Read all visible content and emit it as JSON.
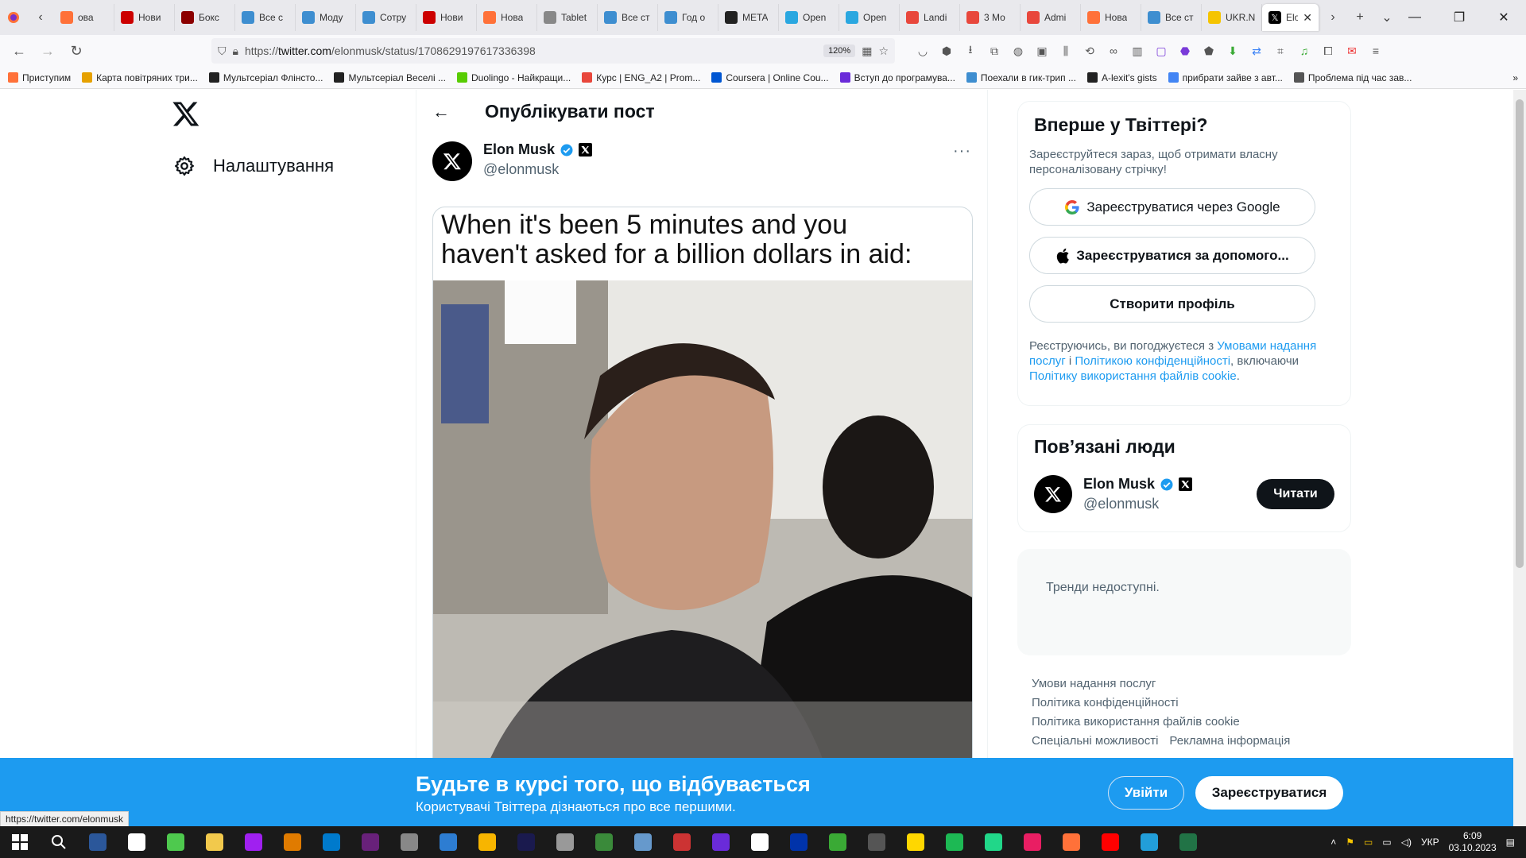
{
  "browser": {
    "tabs": [
      {
        "label": "ова",
        "color": "#ff7139"
      },
      {
        "label": "Нови",
        "color": "#c00"
      },
      {
        "label": "Бокс",
        "color": "#8b0000"
      },
      {
        "label": "Все с",
        "color": "#3e8ed0"
      },
      {
        "label": "Моду",
        "color": "#3e8ed0"
      },
      {
        "label": "Сотру",
        "color": "#3e8ed0"
      },
      {
        "label": "Нови",
        "color": "#c00"
      },
      {
        "label": "Нова",
        "color": "#ff7139"
      },
      {
        "label": "Tablet",
        "color": "#888"
      },
      {
        "label": "Все ст",
        "color": "#3e8ed0"
      },
      {
        "label": "Год о",
        "color": "#3e8ed0"
      },
      {
        "label": "META",
        "color": "#222"
      },
      {
        "label": "Open",
        "color": "#2aa7e0"
      },
      {
        "label": "Open",
        "color": "#2aa7e0"
      },
      {
        "label": "Landi",
        "color": "#e8473c"
      },
      {
        "label": "3 Мо",
        "color": "#e8473c"
      },
      {
        "label": "Admi",
        "color": "#e8473c"
      },
      {
        "label": "Нова",
        "color": "#ff7139"
      },
      {
        "label": "Все ст",
        "color": "#3e8ed0"
      },
      {
        "label": "UKR.N",
        "color": "#f5c400"
      }
    ],
    "active_tab": {
      "label": "Elo",
      "close": "✕"
    },
    "url_prefix": "https://",
    "url_domain": "twitter.com",
    "url_path": "/elonmusk/status/1708629197617336398",
    "zoom": "120%",
    "bookmarks": [
      {
        "label": "Приступим",
        "color": "#ff7139"
      },
      {
        "label": "Карта повітряних три...",
        "color": "#e6a100"
      },
      {
        "label": "Мультсеріал Флінсто...",
        "color": "#222"
      },
      {
        "label": "Мультсеріал Веселі ...",
        "color": "#222"
      },
      {
        "label": "Duolingo - Найкращи...",
        "color": "#58cc02"
      },
      {
        "label": "Курс | ENG_A2 | Prom...",
        "color": "#e8473c"
      },
      {
        "label": "Coursera | Online Cou...",
        "color": "#0056d2"
      },
      {
        "label": "Вступ до програмува...",
        "color": "#6a2bd9"
      },
      {
        "label": "Поехали в гик-трип ...",
        "color": "#3e8ed0"
      },
      {
        "label": "A-lexit's gists",
        "color": "#222"
      },
      {
        "label": "прибрати зайве з авт...",
        "color": "#4285f4"
      },
      {
        "label": "Проблема під час зав...",
        "color": "#555"
      }
    ]
  },
  "sidebar": {
    "settings_label": "Налаштування"
  },
  "post": {
    "header_title": "Опублікувати пост",
    "author_name": "Elon Musk",
    "author_handle": "@elonmusk",
    "more": "···",
    "meme_line1": "When it's been 5 minutes and you",
    "meme_line2": "haven't asked for a billion dollars in aid:"
  },
  "signup": {
    "title": "Вперше у Твіттері?",
    "subtitle": "Зареєструйтеся зараз, щоб отримати власну персоналізовану стрічку!",
    "google_btn": "Зареєструватися через Google",
    "apple_btn": "Зареєструватися за допомого...",
    "create_btn": "Створити профіль",
    "legal_pre": "Реєструючись, ви погоджуєтеся з ",
    "legal_tos": "Умовами надання послуг",
    "legal_and": " і ",
    "legal_privacy": "Політикою конфіденційності",
    "legal_mid": ", включаючи ",
    "legal_cookies": "Політику використання файлів cookie",
    "legal_end": "."
  },
  "related": {
    "title": "Пов’язані люди",
    "name": "Elon Musk",
    "handle": "@elonmusk",
    "follow_label": "Читати"
  },
  "trends": {
    "text": "Тренди недоступні."
  },
  "footer": {
    "links": [
      "Умови надання послуг",
      "Політика конфіденційності",
      "Політика використання файлів cookie",
      "Спеціальні можливості",
      "Рекламна інформація"
    ]
  },
  "banner": {
    "title": "Будьте в курсі того, що відбувається",
    "subtitle": "Користувачі Твіттера дізнаються про все першими.",
    "login": "Увійти",
    "register": "Зареєструватися"
  },
  "status_link": "https://twitter.com/elonmusk",
  "taskbar": {
    "language": "УКР",
    "time": "6:09",
    "date": "03.10.2023",
    "apps": [
      "#2b579a",
      "#ffffff",
      "#4ec94e",
      "#f2c94c",
      "#a020f0",
      "#e07b00",
      "#007acc",
      "#68217a",
      "#888888",
      "#2d7dd2",
      "#f7b500",
      "#1a1a4e",
      "#999999",
      "#3a8a3a",
      "#6699cc",
      "#cc3333",
      "#6a2bd9",
      "#ffffff",
      "#0033aa",
      "#3aaa35",
      "#555555",
      "#ffd700",
      "#1db954",
      "#21d789",
      "#e91e63",
      "#ff7139",
      "#ff0000",
      "#229ed9",
      "#217346"
    ]
  }
}
